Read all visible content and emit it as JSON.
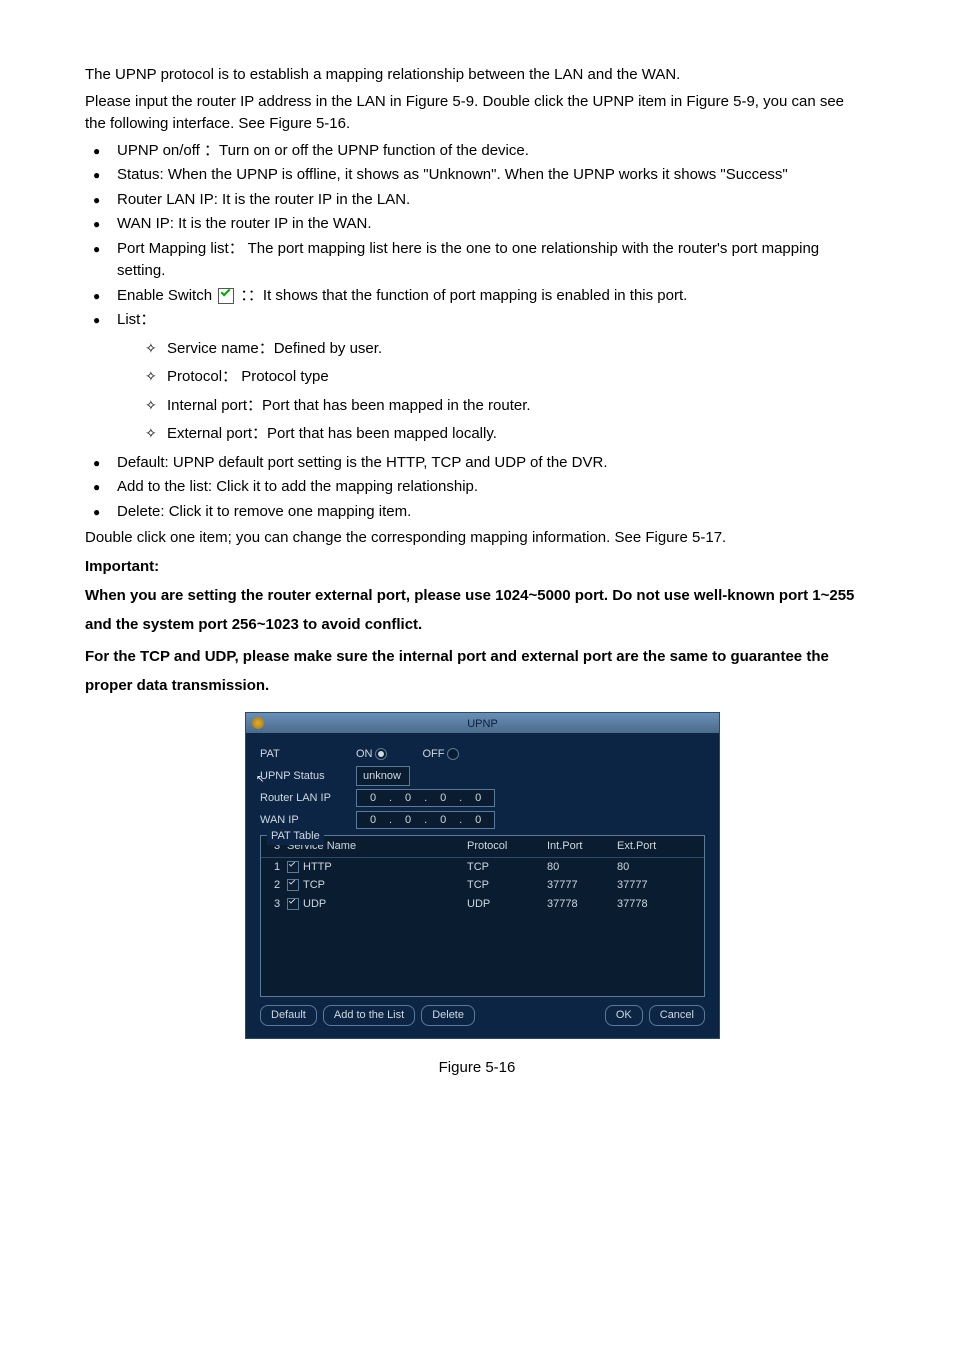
{
  "intro": {
    "p1": "The UPNP protocol is to establish a mapping relationship between the LAN and the WAN.",
    "p2": "Please input the router IP address in the LAN in Figure 5-9. Double click the UPNP item in Figure 5-9, you can see the following interface. See Figure 5-16."
  },
  "bullets": {
    "upnp_onoff": "UPNP  on/off ：Turn on or off the UPNP function of the device.",
    "status": "Status:  When the UPNP is offline, it shows as \"Unknown\". When the UPNP works it shows \"Success\"",
    "router_lan": "Router LAN IP: It is the router IP in the LAN.",
    "wan_ip": "WAN IP: It is the router IP in the WAN.",
    "port_mapping": "Port Mapping list：  The port mapping list here is the one to one relationship with the router's port mapping setting.",
    "enable_prefix": "Enable Switch ",
    "enable_suffix": "：：It shows that the function of port mapping is enabled in this port.",
    "list": "List：",
    "sub_service": "Service name：Defined by user.",
    "sub_protocol": "Protocol： Protocol type",
    "sub_internal": "Internal port：Port that has been mapped in the router.",
    "sub_external": "External port：Port that has been mapped locally.",
    "default": "Default: UPNP default port setting is the HTTP, TCP and UDP of the DVR.",
    "add": "Add to the list: Click it to add the mapping relationship.",
    "delete": "Delete: Click it to remove one mapping item."
  },
  "after_list": "Double click one item; you can change the corresponding mapping information. See Figure 5-17.",
  "important_heading": "Important:",
  "important_p1": "When you are setting the router external port, please use 1024~5000 port. Do not use well-known port 1~255 and the system port 256~1023 to avoid conflict.",
  "important_p2": "For the TCP and UDP, please make sure the internal port and external port are the same to guarantee the proper data transmission.",
  "dialog": {
    "title": "UPNP",
    "labels": {
      "pat": "PAT",
      "on": "ON",
      "off": "OFF",
      "status": "UPNP Status",
      "router_lan": "Router LAN IP",
      "wan_ip": "WAN IP",
      "table_caption": "PAT Table",
      "status_val": "unknow"
    },
    "ip": {
      "router": [
        "0",
        "0",
        "0",
        "0"
      ],
      "wan": [
        "0",
        "0",
        "0",
        "0"
      ]
    },
    "table": {
      "count": "3",
      "headers": {
        "name": "Service Name",
        "proto": "Protocol",
        "intp": "Int.Port",
        "extp": "Ext.Port"
      },
      "rows": [
        {
          "idx": "1",
          "name": "HTTP",
          "proto": "TCP",
          "intp": "80",
          "extp": "80"
        },
        {
          "idx": "2",
          "name": "TCP",
          "proto": "TCP",
          "intp": "37777",
          "extp": "37777"
        },
        {
          "idx": "3",
          "name": "UDP",
          "proto": "UDP",
          "intp": "37778",
          "extp": "37778"
        }
      ]
    },
    "buttons": {
      "default": "Default",
      "add": "Add to the List",
      "delete": "Delete",
      "ok": "OK",
      "cancel": "Cancel"
    }
  },
  "figure": "Figure 5-16"
}
